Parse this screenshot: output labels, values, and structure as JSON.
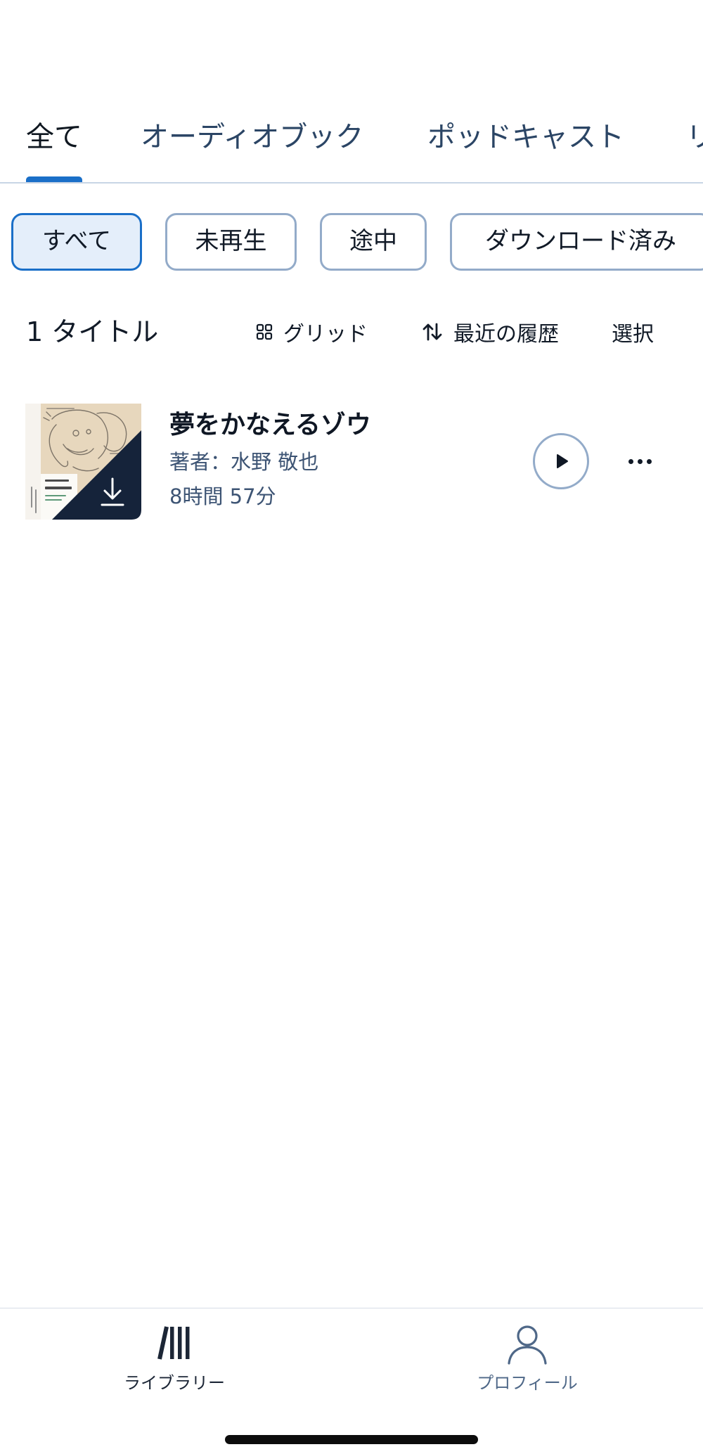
{
  "tabs": [
    {
      "label": "全て",
      "active": true
    },
    {
      "label": "オーディオブック",
      "active": false
    },
    {
      "label": "ポッドキャスト",
      "active": false
    },
    {
      "label": "リ",
      "active": false
    }
  ],
  "filters": [
    {
      "label": "すべて",
      "selected": true
    },
    {
      "label": "未再生",
      "selected": false
    },
    {
      "label": "途中",
      "selected": false
    },
    {
      "label": "ダウンロード済み",
      "selected": false
    }
  ],
  "toolbar": {
    "count_label": "1 タイトル",
    "view_label": "グリッド",
    "view_icon": "grid-icon",
    "sort_label": "最近の履歴",
    "sort_icon": "sort-icon",
    "select_label": "選択"
  },
  "books": [
    {
      "title": "夢をかなえるゾウ",
      "author": "著者：水野 敬也",
      "duration": "8時間 57分",
      "downloaded": true,
      "badge_icon": "download-icon",
      "play_icon": "play-icon",
      "more_icon": "more-horizontal-icon"
    }
  ],
  "bottom_nav": [
    {
      "label": "ライブラリー",
      "icon": "library-icon",
      "active": true
    },
    {
      "label": "プロフィール",
      "icon": "profile-icon",
      "active": false
    }
  ],
  "colors": {
    "accent": "#1a6fc8",
    "tab_inactive": "#2b4565",
    "text_strong": "#0f1720",
    "text_secondary": "#3d5474",
    "divider": "#c8d5e5",
    "chip_border": "#93abc9",
    "chip_selected_bg": "#e4eefa",
    "nav_inactive": "#4f6888",
    "cover_badge": "#15233a"
  }
}
